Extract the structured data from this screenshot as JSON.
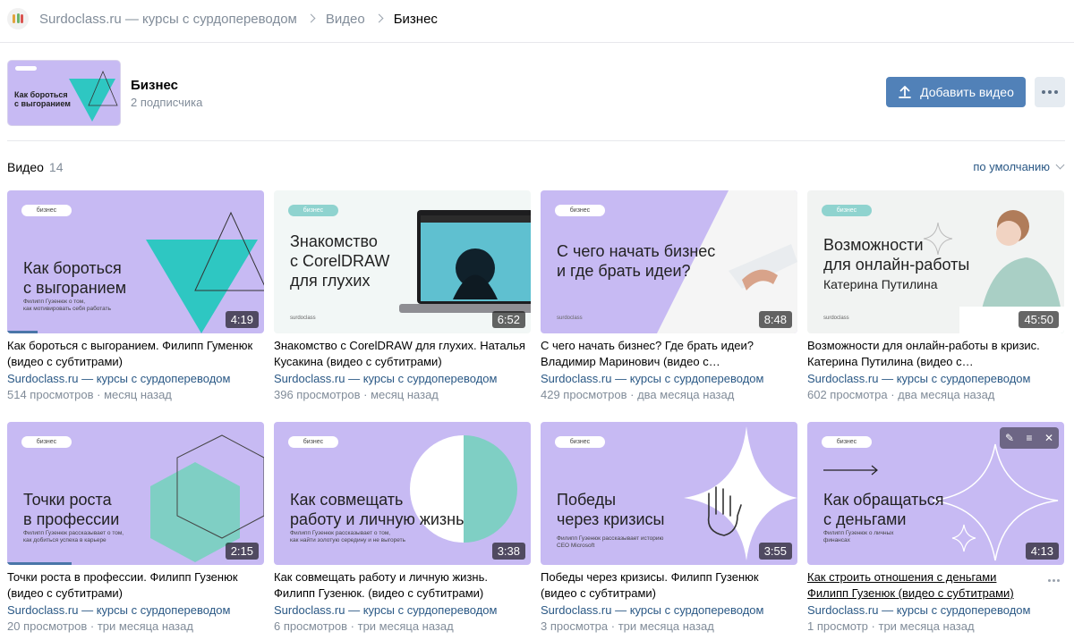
{
  "breadcrumb": {
    "items": [
      "Surdoclass.ru — курсы с сурдопереводом",
      "Видео",
      "Бизнес"
    ]
  },
  "album": {
    "cover_title": "Как бороться\nс выгоранием",
    "title": "Бизнес",
    "subscribers": "2 подписчика"
  },
  "actions": {
    "add_video": "Добавить видео"
  },
  "section": {
    "label": "Видео",
    "count": "14",
    "sort": "по умолчанию"
  },
  "colors": {
    "accent": "#5181b8",
    "link": "#2a5885",
    "purple": "#c7baf3",
    "teal": "#2ec7c2"
  },
  "videos": [
    {
      "tag": "бизнес",
      "headline": "Как бороться\nс выгоранием",
      "caption": "Филипп Гузенюк о том,\nкак мотивировать себя работать",
      "duration": "4:19",
      "progress": 0.12,
      "title": "Как бороться с выгоранием. Филипп Гуменюк (видео с субтитрами)",
      "channel": "Surdoclass.ru — курсы с сурдопереводом",
      "views": "514 просмотров",
      "when": "месяц назад"
    },
    {
      "tag": "бизнес",
      "headline": "Знакомство\nс CorelDRAW\nдля глухих",
      "caption": "",
      "brand": "surdoclass",
      "duration": "6:52",
      "progress": 0,
      "title": "Знакомство с CorelDRAW для глухих. Наталья Кусакина (видео с субтитрами)",
      "channel": "Surdoclass.ru — курсы с сурдопереводом",
      "views": "396 просмотров",
      "when": "месяц назад"
    },
    {
      "tag": "бизнес",
      "headline": "С чего начать бизнес\nи где брать идеи?",
      "caption": "",
      "brand": "surdoclass",
      "duration": "8:48",
      "progress": 0,
      "title": "С чего начать бизнес? Где брать идеи? Владимир Маринович (видео с…",
      "channel": "Surdoclass.ru — курсы с сурдопереводом",
      "views": "429 просмотров",
      "when": "два месяца назад"
    },
    {
      "tag": "бизнес",
      "headline": "Возможности\nдля онлайн-работы",
      "caption": "",
      "sub": "Катерина Путилина",
      "brand": "surdoclass",
      "duration": "45:50",
      "progress": 0,
      "title": "Возможности для онлайн-работы в кризис. Катерина Путилина (видео с…",
      "channel": "Surdoclass.ru — курсы с сурдопереводом",
      "views": "602 просмотра",
      "when": "два месяца назад"
    },
    {
      "tag": "бизнес",
      "headline": "Точки роста\nв профессии",
      "caption": "Филипп Гузенюк рассказывает о том,\nкак добиться успеха в карьере",
      "duration": "2:15",
      "progress": 0.25,
      "title": "Точки роста в профессии. Филипп Гузенюк (видео с субтитрами)",
      "channel": "Surdoclass.ru — курсы с сурдопереводом",
      "views": "20 просмотров",
      "when": "три месяца назад"
    },
    {
      "tag": "бизнес",
      "headline": "Как совмещать\nработу и личную жизнь",
      "caption": "Филипп Гузенюк рассказывает о том,\nкак найти золотую середину и не выгореть",
      "duration": "3:38",
      "progress": 0,
      "title": "Как совмещать работу и личную жизнь. Филипп Гузенюк. (видео с субтитрами)",
      "channel": "Surdoclass.ru — курсы с сурдопереводом",
      "views": "6 просмотров",
      "when": "три месяца назад"
    },
    {
      "tag": "бизнес",
      "headline": "Победы\nчерез кризисы",
      "caption": "Филипп Гузенюк рассказывает историю\nCEO Microsoft",
      "duration": "3:55",
      "progress": 0,
      "title": "Победы через кризисы. Филипп Гузенюк (видео с субтитрами)",
      "channel": "Surdoclass.ru — курсы с сурдопереводом",
      "views": "3 просмотра",
      "when": "три месяца назад"
    },
    {
      "tag": "бизнес",
      "headline": "Как обращаться\nс деньгами",
      "caption": "Филипп Гузенюк о личных\nфинансах",
      "duration": "4:13",
      "progress": 0,
      "title": "Как строить отношения с деньгами Филипп Гузенюк (видео с субтитрами)",
      "channel": "Surdoclass.ru — курсы с сурдопереводом",
      "views": "1 просмотр",
      "when": "три месяца назад"
    }
  ]
}
